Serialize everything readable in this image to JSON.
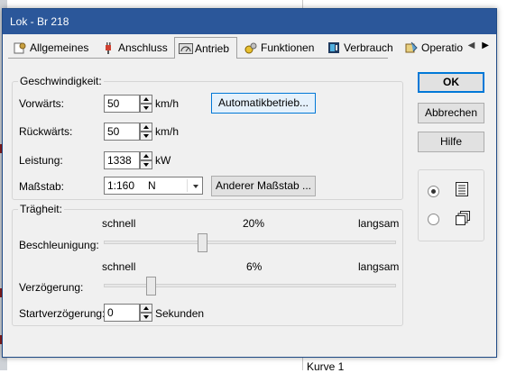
{
  "window": {
    "title": "Lok - Br 218"
  },
  "tabs": [
    {
      "label": "Allgemeines",
      "icon": "settings-doc-icon"
    },
    {
      "label": "Anschluss",
      "icon": "plug-icon"
    },
    {
      "label": "Antrieb",
      "icon": "speedometer-icon",
      "active": true
    },
    {
      "label": "Funktionen",
      "icon": "function-keys-icon"
    },
    {
      "label": "Verbrauch",
      "icon": "fuel-pump-icon"
    },
    {
      "label": "Operatio",
      "icon": "operation-icon"
    }
  ],
  "speed": {
    "group_title": "Geschwindigkeit:",
    "forward_label": "Vorwärts:",
    "forward_value": "50",
    "backward_label": "Rückwärts:",
    "backward_value": "50",
    "unit_kmh": "km/h",
    "power_label": "Leistung:",
    "power_value": "1338",
    "unit_kw": "kW",
    "scale_label": "Maßstab:",
    "scale_value": "1:160",
    "scale_gauge": "N",
    "auto_button": "Automatikbetrieb...",
    "other_scale_button": "Anderer Maßstab ..."
  },
  "inertia": {
    "group_title": "Trägheit:",
    "fast": "schnell",
    "slow": "langsam",
    "accel_label": "Beschleunigung:",
    "accel_percent": "20%",
    "accel_value": 0.2,
    "decel_label": "Verzögerung:",
    "decel_percent": "6%",
    "decel_value": 0.06,
    "start_delay_label": "Startverzögerung:",
    "start_delay_value": "0",
    "start_delay_unit": "Sekunden"
  },
  "buttons": {
    "ok": "OK",
    "cancel": "Abbrechen",
    "help": "Hilfe"
  },
  "view_mode": {
    "selected": "list"
  },
  "background": {
    "text": "Kurve 1"
  },
  "colors": {
    "titlebar": "#2b579a",
    "focus": "#0078d7"
  }
}
